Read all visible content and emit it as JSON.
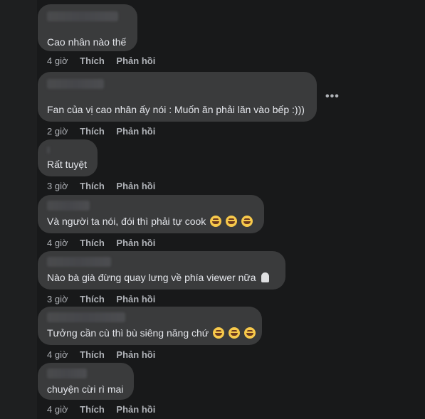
{
  "comments": [
    {
      "text": "Cao nhân nào thế",
      "time": "4 giờ",
      "like": "Thích",
      "reply": "Phản hồi"
    },
    {
      "text": "Fan của vị cao nhân ấy nói : Muốn ăn phải lăn vào bếp :)))",
      "time": "2 giờ",
      "like": "Thích",
      "reply": "Phản hồi"
    },
    {
      "text": "Rất tuyệt",
      "time": "3 giờ",
      "like": "Thích",
      "reply": "Phản hồi"
    },
    {
      "text": "Và người ta nói, đói thì phải tự cook",
      "time": "4 giờ",
      "like": "Thích",
      "reply": "Phản hồi"
    },
    {
      "text": "Nào bà già đừng quay lưng về phía viewer nữa",
      "time": "3 giờ",
      "like": "Thích",
      "reply": "Phản hồi"
    },
    {
      "text": "Tưởng cần cù thì bù siêng năng chứ",
      "time": "4 giờ",
      "like": "Thích",
      "reply": "Phản hồi"
    },
    {
      "text": "chuyện cừi rì mai",
      "time": "4 giờ",
      "like": "Thích",
      "reply": "Phản hồi"
    }
  ],
  "more_label": "•••",
  "icons": {
    "emoji": "laughing-emoji-icon",
    "ghost": "ghost-emoji-icon",
    "more": "more-options-icon"
  }
}
